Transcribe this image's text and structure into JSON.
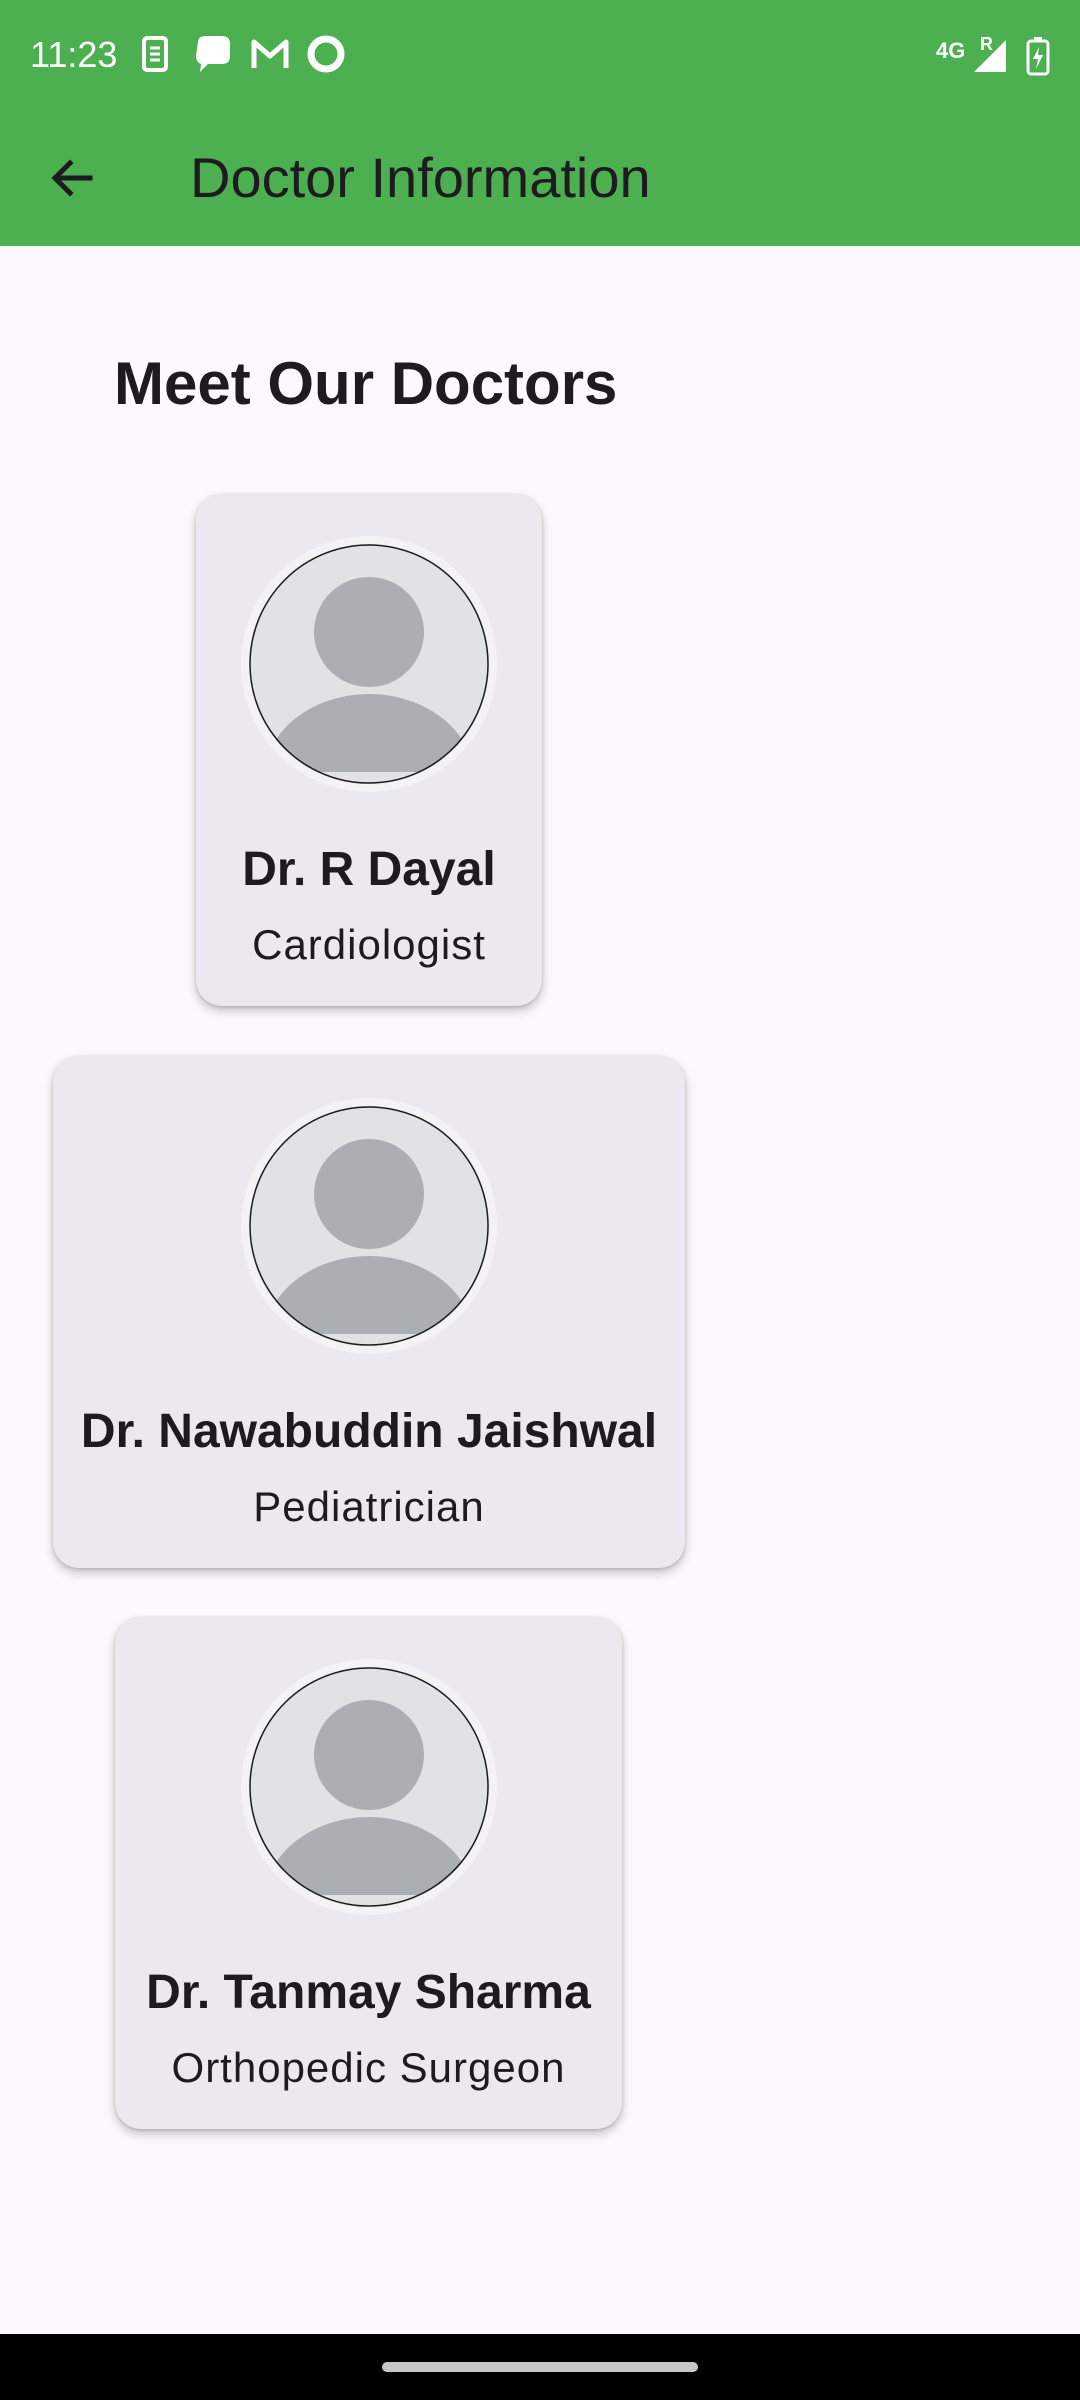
{
  "status_bar": {
    "time": "11:23",
    "network": "4G",
    "roaming": "R",
    "notification_icons": [
      "sim-toolkit-icon",
      "chat-bubble-icon",
      "gmail-icon",
      "ring-app-icon"
    ],
    "right_icons": [
      "signal-icon",
      "battery-charging-icon"
    ]
  },
  "app_bar": {
    "back_icon": "arrow-back-icon",
    "title": "Doctor Information",
    "color": "#4caf50"
  },
  "main": {
    "heading": "Meet Our Doctors",
    "doctors": [
      {
        "name": "Dr. R Dayal",
        "specialty": "Cardiologist",
        "avatar_icon": "person-placeholder-icon"
      },
      {
        "name": "Dr. Nawabuddin Jaishwal",
        "specialty": "Pediatrician",
        "avatar_icon": "person-placeholder-icon"
      },
      {
        "name": "Dr. Tanmay Sharma",
        "specialty": "Orthopedic Surgeon",
        "avatar_icon": "person-placeholder-icon"
      }
    ]
  }
}
